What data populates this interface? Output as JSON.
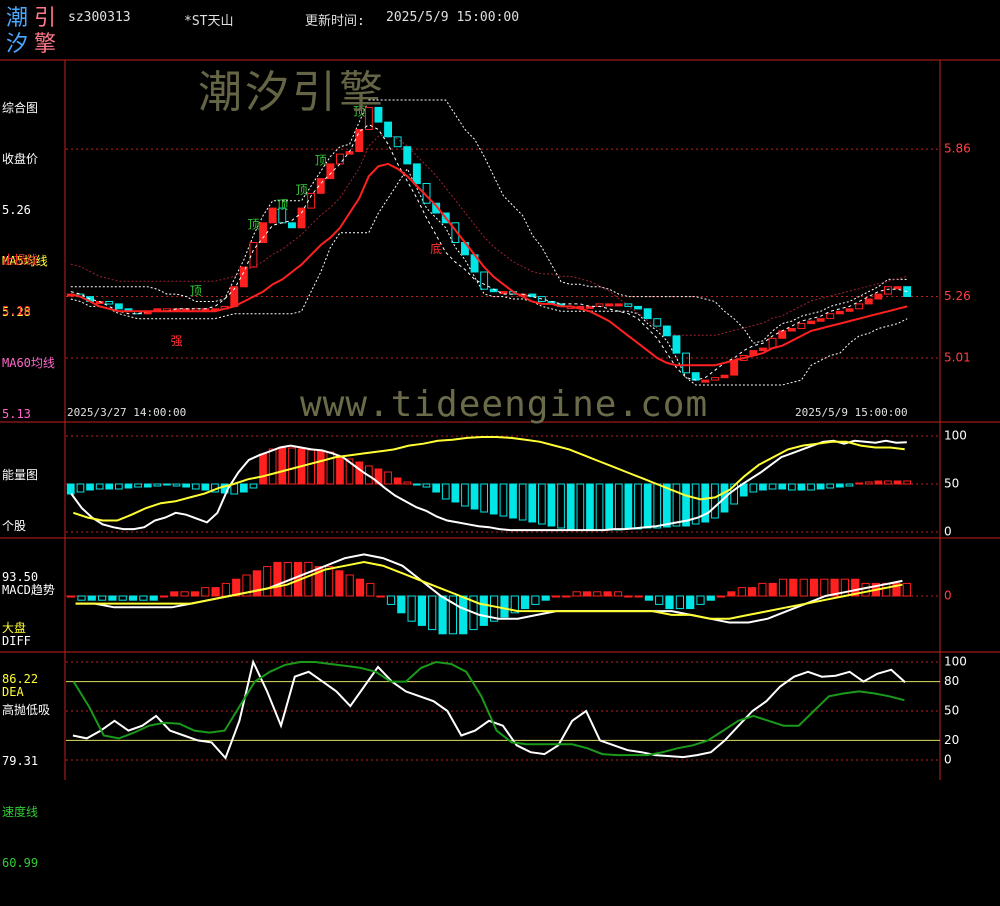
{
  "header": {
    "code": "sz300313",
    "name": "*ST天山",
    "update_label": "更新时间:",
    "update_time": "2025/5/9 15:00:00"
  },
  "logo": {
    "chars": [
      "潮",
      "引",
      "汐",
      "擎"
    ]
  },
  "watermark": {
    "cn": "潮汐引擎",
    "url": "www.tideengine.com"
  },
  "colors": {
    "up": "#ff2020",
    "down": "#00e5e5",
    "ma5": "#ffffff",
    "ma60": "#ff3060",
    "frame": "#c02020"
  },
  "panels": {
    "main": {
      "title": "综合图",
      "close_label": "收盘价",
      "close_value": "5.26",
      "ma5_label": "MA5均线",
      "ma5_value": "5.28",
      "ma60_label": "MA60均线",
      "ma60_value": "5.13",
      "stop_label": "止损线",
      "stop_value": "5.18",
      "date_start": "2025/3/27 14:00:00",
      "date_end": "2025/5/9 15:00:00",
      "markers": {
        "top": "顶",
        "strong": "强",
        "bottom": "底"
      }
    },
    "energy": {
      "title": "能量图",
      "stock_label": "个股",
      "stock_value": "93.50",
      "market_label": "大盘",
      "market_value": "86.22"
    },
    "macd": {
      "title": "MACD趋势",
      "diff_label": "DIFF",
      "dea_label": "DEA"
    },
    "hl": {
      "title": "高抛低吸",
      "value": "79.31",
      "speed_label": "速度线",
      "speed_value": "60.99"
    }
  },
  "chart_data": [
    {
      "type": "candlestick",
      "panel": "综合图",
      "series": [
        {
          "name": "收盘价",
          "values": [
            5.27,
            5.26,
            5.24,
            5.24,
            5.23,
            5.21,
            5.2,
            5.19,
            5.2,
            5.21,
            5.21,
            5.21,
            5.21,
            5.21,
            5.21,
            5.21,
            5.22,
            5.3,
            5.38,
            5.48,
            5.56,
            5.62,
            5.56,
            5.54,
            5.62,
            5.68,
            5.74,
            5.8,
            5.84,
            5.85,
            5.94,
            6.03,
            5.97,
            5.91,
            5.87,
            5.8,
            5.72,
            5.64,
            5.6,
            5.56,
            5.48,
            5.43,
            5.36,
            5.29,
            5.28,
            5.28,
            5.27,
            5.27,
            5.26,
            5.24,
            5.23,
            5.22,
            5.22,
            5.22,
            5.22,
            5.23,
            5.23,
            5.23,
            5.22,
            5.21,
            5.17,
            5.14,
            5.1,
            5.03,
            4.95,
            4.92,
            4.92,
            4.93,
            4.94,
            5.0,
            5.02,
            5.04,
            5.05,
            5.09,
            5.12,
            5.13,
            5.15,
            5.16,
            5.17,
            5.19,
            5.2,
            5.21,
            5.23,
            5.25,
            5.27,
            5.3,
            5.3,
            5.26
          ]
        },
        {
          "name": "MA5均线",
          "values": [
            5.28,
            5.27,
            5.25,
            5.24,
            5.22,
            5.2,
            5.19,
            5.19,
            5.2,
            5.2,
            5.2,
            5.21,
            5.21,
            5.21,
            5.21,
            5.22,
            5.25,
            5.29,
            5.36,
            5.45,
            5.5,
            5.55,
            5.56,
            5.57,
            5.6,
            5.67,
            5.72,
            5.76,
            5.8,
            5.85,
            5.93,
            5.96,
            5.94,
            5.88,
            5.8,
            5.73,
            5.66,
            5.58,
            5.51,
            5.44,
            5.4,
            5.37,
            5.33,
            5.31,
            5.29,
            5.27,
            5.27,
            5.27,
            5.26,
            5.25,
            5.24,
            5.23,
            5.23,
            5.23,
            5.22,
            5.22,
            5.21,
            5.2,
            5.19,
            5.17,
            5.13,
            5.09,
            5.03,
            4.97,
            4.93,
            4.92,
            4.93,
            4.96,
            4.99,
            5.01,
            5.04,
            5.06,
            5.07,
            5.1,
            5.12,
            5.14,
            5.16,
            5.17,
            5.18,
            5.2,
            5.21,
            5.22,
            5.24,
            5.26,
            5.28,
            5.29,
            5.29,
            5.28
          ]
        },
        {
          "name": "MA60均线",
          "values": [
            5.27,
            5.26,
            5.24,
            5.22,
            5.21,
            5.2,
            5.2,
            5.2,
            5.2,
            5.2,
            5.2,
            5.2,
            5.2,
            5.2,
            5.2,
            5.2,
            5.21,
            5.22,
            5.24,
            5.26,
            5.28,
            5.31,
            5.33,
            5.36,
            5.39,
            5.43,
            5.47,
            5.5,
            5.54,
            5.6,
            5.66,
            5.75,
            5.79,
            5.8,
            5.78,
            5.75,
            5.71,
            5.67,
            5.63,
            5.58,
            5.53,
            5.48,
            5.43,
            5.38,
            5.34,
            5.31,
            5.28,
            5.26,
            5.24,
            5.23,
            5.23,
            5.22,
            5.22,
            5.21,
            5.2,
            5.18,
            5.16,
            5.13,
            5.1,
            5.07,
            5.04,
            5.01,
            4.99,
            4.98,
            4.98,
            4.98,
            4.98,
            4.98,
            4.99,
            5.0,
            5.01,
            5.02,
            5.03,
            5.05,
            5.06,
            5.08,
            5.1,
            5.12,
            5.13,
            5.14,
            5.15,
            5.16,
            5.17,
            5.18,
            5.19,
            5.2,
            5.21,
            5.22
          ]
        }
      ],
      "ticks": [
        "5.86",
        "5.26",
        "5.01"
      ]
    },
    {
      "type": "bar",
      "panel": "能量图",
      "ticks": [
        "100",
        "50",
        "0"
      ],
      "bar_values": [
        -10,
        -8,
        -6,
        -5,
        -5,
        -5,
        -4,
        -3,
        -3,
        -2,
        -1,
        -2,
        -3,
        -5,
        -6,
        -8,
        -9,
        -10,
        -8,
        -4,
        30,
        35,
        36,
        36,
        35,
        34,
        33,
        32,
        28,
        25,
        22,
        18,
        15,
        12,
        6,
        2,
        -1,
        -3,
        -8,
        -15,
        -18,
        -22,
        -25,
        -28,
        -30,
        -32,
        -34,
        -36,
        -38,
        -40,
        -42,
        -44,
        -45,
        -46,
        -46,
        -46,
        -46,
        -46,
        -45,
        -45,
        -44,
        -44,
        -43,
        -42,
        -42,
        -40,
        -38,
        -34,
        -28,
        -20,
        -12,
        -8,
        -6,
        -5,
        -5,
        -6,
        -6,
        -6,
        -5,
        -4,
        -3,
        -2,
        1,
        2,
        3,
        3,
        3,
        3
      ],
      "series": [
        {
          "name": "个股",
          "values": [
            40,
            25,
            15,
            8,
            5,
            3,
            3,
            5,
            12,
            15,
            20,
            18,
            14,
            10,
            20,
            45,
            62,
            75,
            80,
            84,
            88,
            90,
            88,
            86,
            85,
            82,
            78,
            70,
            62,
            55,
            46,
            38,
            32,
            26,
            22,
            16,
            12,
            10,
            8,
            6,
            5,
            3,
            2,
            2,
            2,
            2,
            2,
            2,
            2,
            2,
            2,
            2,
            3,
            3,
            4,
            5,
            6,
            8,
            10,
            12,
            15,
            20,
            30,
            40,
            48,
            55,
            62,
            70,
            78,
            82,
            86,
            90,
            94,
            95,
            92,
            95,
            94,
            93,
            95,
            93,
            93.5
          ]
        },
        {
          "name": "大盘",
          "values": [
            20,
            15,
            12,
            12,
            18,
            25,
            30,
            32,
            36,
            40,
            46,
            50,
            55,
            58,
            62,
            66,
            70,
            74,
            78,
            80,
            82,
            84,
            86,
            90,
            92,
            95,
            96,
            98,
            99,
            99,
            98,
            96,
            94,
            90,
            86,
            80,
            74,
            68,
            62,
            56,
            50,
            44,
            38,
            34,
            36,
            44,
            58,
            70,
            78,
            86,
            90,
            92,
            94,
            94,
            90,
            88,
            88,
            86.22
          ]
        }
      ]
    },
    {
      "type": "bar",
      "panel": "MACD趋势",
      "ticks": [
        "0"
      ],
      "bar_values": [
        0,
        -0.01,
        -0.01,
        -0.01,
        -0.01,
        -0.01,
        -0.01,
        -0.01,
        -0.01,
        0,
        0.01,
        0.01,
        0.01,
        0.02,
        0.02,
        0.03,
        0.04,
        0.05,
        0.06,
        0.07,
        0.08,
        0.08,
        0.08,
        0.08,
        0.07,
        0.07,
        0.06,
        0.05,
        0.04,
        0.03,
        0,
        -0.02,
        -0.04,
        -0.06,
        -0.07,
        -0.08,
        -0.09,
        -0.09,
        -0.09,
        -0.08,
        -0.07,
        -0.06,
        -0.05,
        -0.04,
        -0.03,
        -0.02,
        -0.01,
        0,
        0,
        0.01,
        0.01,
        0.01,
        0.01,
        0.01,
        0,
        0,
        -0.01,
        -0.02,
        -0.03,
        -0.03,
        -0.03,
        -0.02,
        -0.01,
        0,
        0.01,
        0.02,
        0.02,
        0.03,
        0.03,
        0.04,
        0.04,
        0.04,
        0.04,
        0.04,
        0.04,
        0.04,
        0.04,
        0.03,
        0.03,
        0.03,
        0.03,
        0.03
      ],
      "series": [
        {
          "name": "DIFF",
          "values": [
            -0.02,
            -0.02,
            -0.03,
            -0.03,
            -0.03,
            -0.03,
            -0.02,
            -0.01,
            0,
            0.01,
            0.02,
            0.04,
            0.06,
            0.08,
            0.1,
            0.11,
            0.1,
            0.08,
            0.04,
            0,
            -0.03,
            -0.05,
            -0.06,
            -0.06,
            -0.05,
            -0.04,
            -0.04,
            -0.04,
            -0.04,
            -0.04,
            -0.04,
            -0.04,
            -0.05,
            -0.06,
            -0.07,
            -0.07,
            -0.06,
            -0.04,
            -0.02,
            0,
            0.01,
            0.02,
            0.03,
            0.04
          ]
        },
        {
          "name": "DEA",
          "values": [
            -0.02,
            -0.02,
            -0.02,
            -0.02,
            -0.02,
            -0.02,
            -0.02,
            -0.01,
            0,
            0.01,
            0.02,
            0.03,
            0.05,
            0.07,
            0.08,
            0.09,
            0.08,
            0.06,
            0.04,
            0.02,
            0,
            -0.02,
            -0.03,
            -0.04,
            -0.04,
            -0.04,
            -0.04,
            -0.04,
            -0.04,
            -0.04,
            -0.04,
            -0.05,
            -0.05,
            -0.06,
            -0.06,
            -0.05,
            -0.04,
            -0.03,
            -0.02,
            -0.01,
            0,
            0.01,
            0.02,
            0.03
          ]
        }
      ]
    },
    {
      "type": "line",
      "panel": "高抛低吸",
      "ticks": [
        "100",
        "80",
        "50",
        "20",
        "0"
      ],
      "series": [
        {
          "name": "高抛低吸",
          "values": [
            25,
            22,
            30,
            40,
            30,
            35,
            45,
            30,
            25,
            20,
            18,
            2,
            40,
            100,
            70,
            35,
            85,
            90,
            80,
            70,
            55,
            75,
            95,
            80,
            70,
            65,
            60,
            50,
            25,
            30,
            40,
            35,
            15,
            8,
            6,
            15,
            40,
            50,
            20,
            15,
            10,
            8,
            5,
            4,
            3,
            5,
            8,
            20,
            35,
            50,
            60,
            75,
            85,
            90,
            85,
            86,
            90,
            80,
            88,
            92,
            79.31
          ]
        },
        {
          "name": "速度线",
          "values": [
            80,
            55,
            25,
            22,
            28,
            35,
            38,
            37,
            30,
            28,
            30,
            55,
            80,
            90,
            97,
            100,
            100,
            98,
            96,
            94,
            90,
            80,
            80,
            94,
            100,
            98,
            90,
            65,
            30,
            18,
            16,
            16,
            16,
            16,
            12,
            6,
            5,
            5,
            5,
            8,
            12,
            15,
            20,
            30,
            40,
            45,
            40,
            35,
            35,
            50,
            65,
            68,
            70,
            68,
            65,
            60.99
          ]
        }
      ]
    }
  ]
}
